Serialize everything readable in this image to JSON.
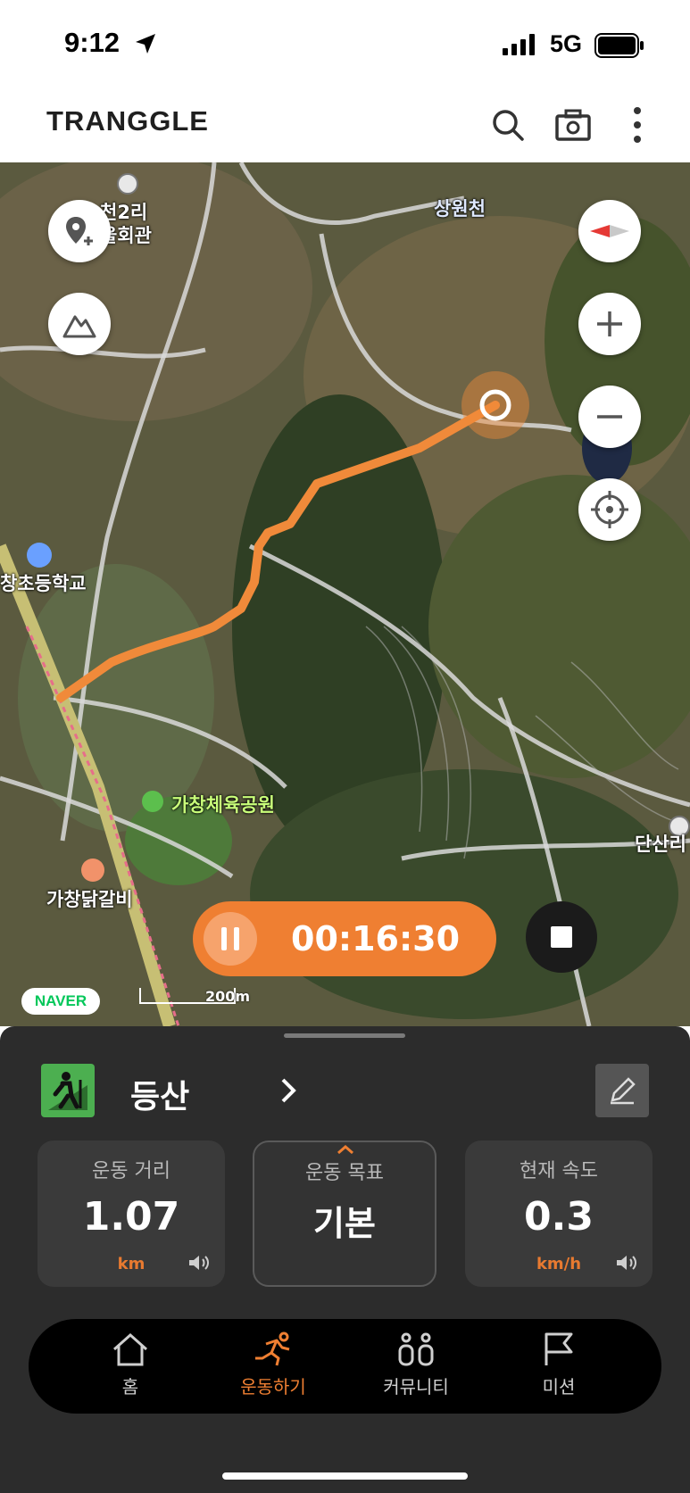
{
  "status_bar": {
    "time": "9:12",
    "network": "5G"
  },
  "app_bar": {
    "logo": "TRANGGLE",
    "icons": [
      "search-icon",
      "camera-icon",
      "more-vertical-icon"
    ]
  },
  "map": {
    "labels": [
      {
        "text": "천2리",
        "key": "a"
      },
      {
        "text": "을회관",
        "key": "b"
      },
      {
        "text": "상원천",
        "key": "c"
      },
      {
        "text": "창초등학교",
        "key": "d"
      },
      {
        "text": "가창체육공원",
        "key": "e"
      },
      {
        "text": "가창닭갈비",
        "key": "f"
      },
      {
        "text": "단산리",
        "key": "g"
      }
    ],
    "attribution": "NAVER",
    "scale": "200m",
    "route_color": "#f08a3a"
  },
  "timer": {
    "elapsed": "00:16:30"
  },
  "activity": {
    "name": "등산"
  },
  "stats": {
    "distance": {
      "label": "운동 거리",
      "value": "1.07",
      "unit": "km"
    },
    "goal": {
      "label": "운동 목표",
      "value": "기본"
    },
    "speed": {
      "label": "현재 속도",
      "value": "0.3",
      "unit": "km/h"
    }
  },
  "nav": {
    "items": [
      {
        "label": "홈"
      },
      {
        "label": "운동하기"
      },
      {
        "label": "커뮤니티"
      },
      {
        "label": "미션"
      }
    ]
  },
  "colors": {
    "accent": "#ef7f32",
    "panel": "#2c2c2c"
  }
}
